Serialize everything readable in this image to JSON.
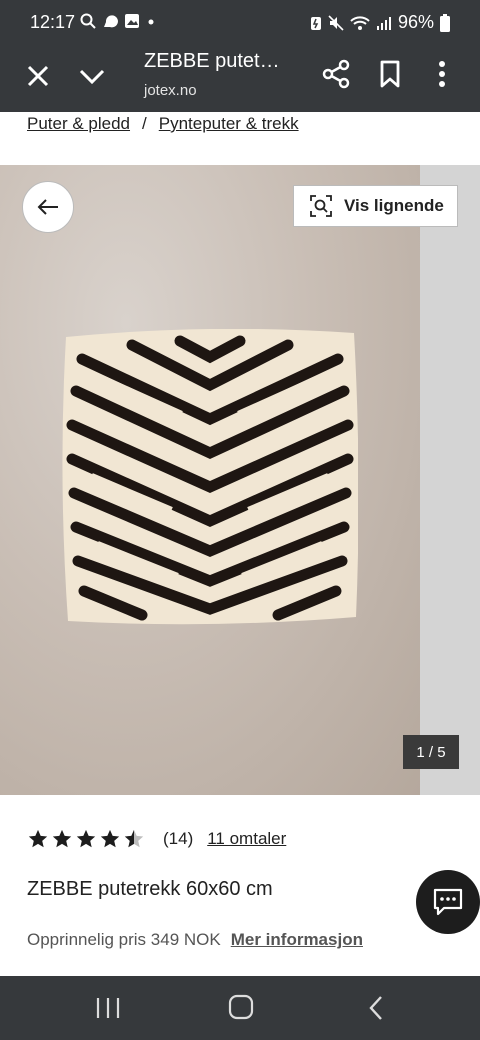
{
  "status_bar": {
    "time": "12:17",
    "battery": "96%"
  },
  "toolbar": {
    "title": "ZEBBE putet…",
    "domain": "jotex.no"
  },
  "breadcrumb": {
    "items": [
      "Puter & pledd",
      "Pynteputer & trekk"
    ],
    "separator": "/"
  },
  "gallery": {
    "similar_label": "Vis lignende",
    "counter": "1 / 5"
  },
  "product": {
    "rating": {
      "stars": 4.5,
      "count": "(14)",
      "reviews_link": "11 omtaler"
    },
    "name": "ZEBBE putetrekk 60x60 cm",
    "original_price": "Opprinnelig pris 349 NOK",
    "more_info": "Mer informasjon"
  },
  "colors": {
    "chrome": "#36393c",
    "text": "#222222",
    "pattern_dark": "#1e1612",
    "pattern_light": "#f1e6d3"
  }
}
